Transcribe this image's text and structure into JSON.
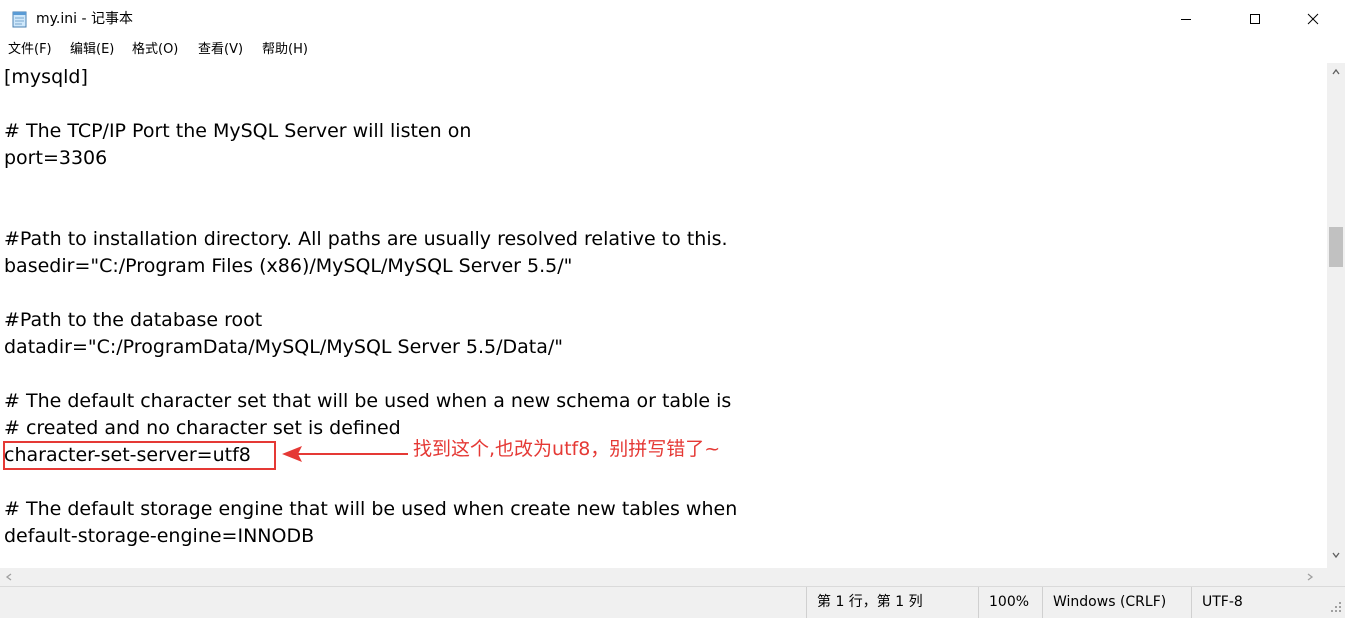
{
  "window": {
    "title": "my.ini - 记事本",
    "icon": "notepad-icon"
  },
  "menu": {
    "items": [
      "文件(F)",
      "编辑(E)",
      "格式(O)",
      "查看(V)",
      "帮助(H)"
    ]
  },
  "editor": {
    "lines": [
      "[mysqld]",
      "",
      "# The TCP/IP Port the MySQL Server will listen on",
      "port=3306",
      "",
      "",
      "#Path to installation directory. All paths are usually resolved relative to this.",
      "basedir=\"C:/Program Files (x86)/MySQL/MySQL Server 5.5/\"",
      "",
      "#Path to the database root",
      "datadir=\"C:/ProgramData/MySQL/MySQL Server 5.5/Data/\"",
      "",
      "# The default character set that will be used when a new schema or table is",
      "# created and no character set is defined",
      "character-set-server=utf8",
      "",
      "# The default storage engine that will be used when create new tables when",
      "default-storage-engine=INNODB"
    ]
  },
  "annotation": {
    "text": "找到这个,也改为utf8，别拼写错了~",
    "color": "#e53935"
  },
  "status": {
    "position": "第 1 行，第 1 列",
    "zoom": "100%",
    "line_ending": "Windows (CRLF)",
    "encoding": "UTF-8"
  }
}
